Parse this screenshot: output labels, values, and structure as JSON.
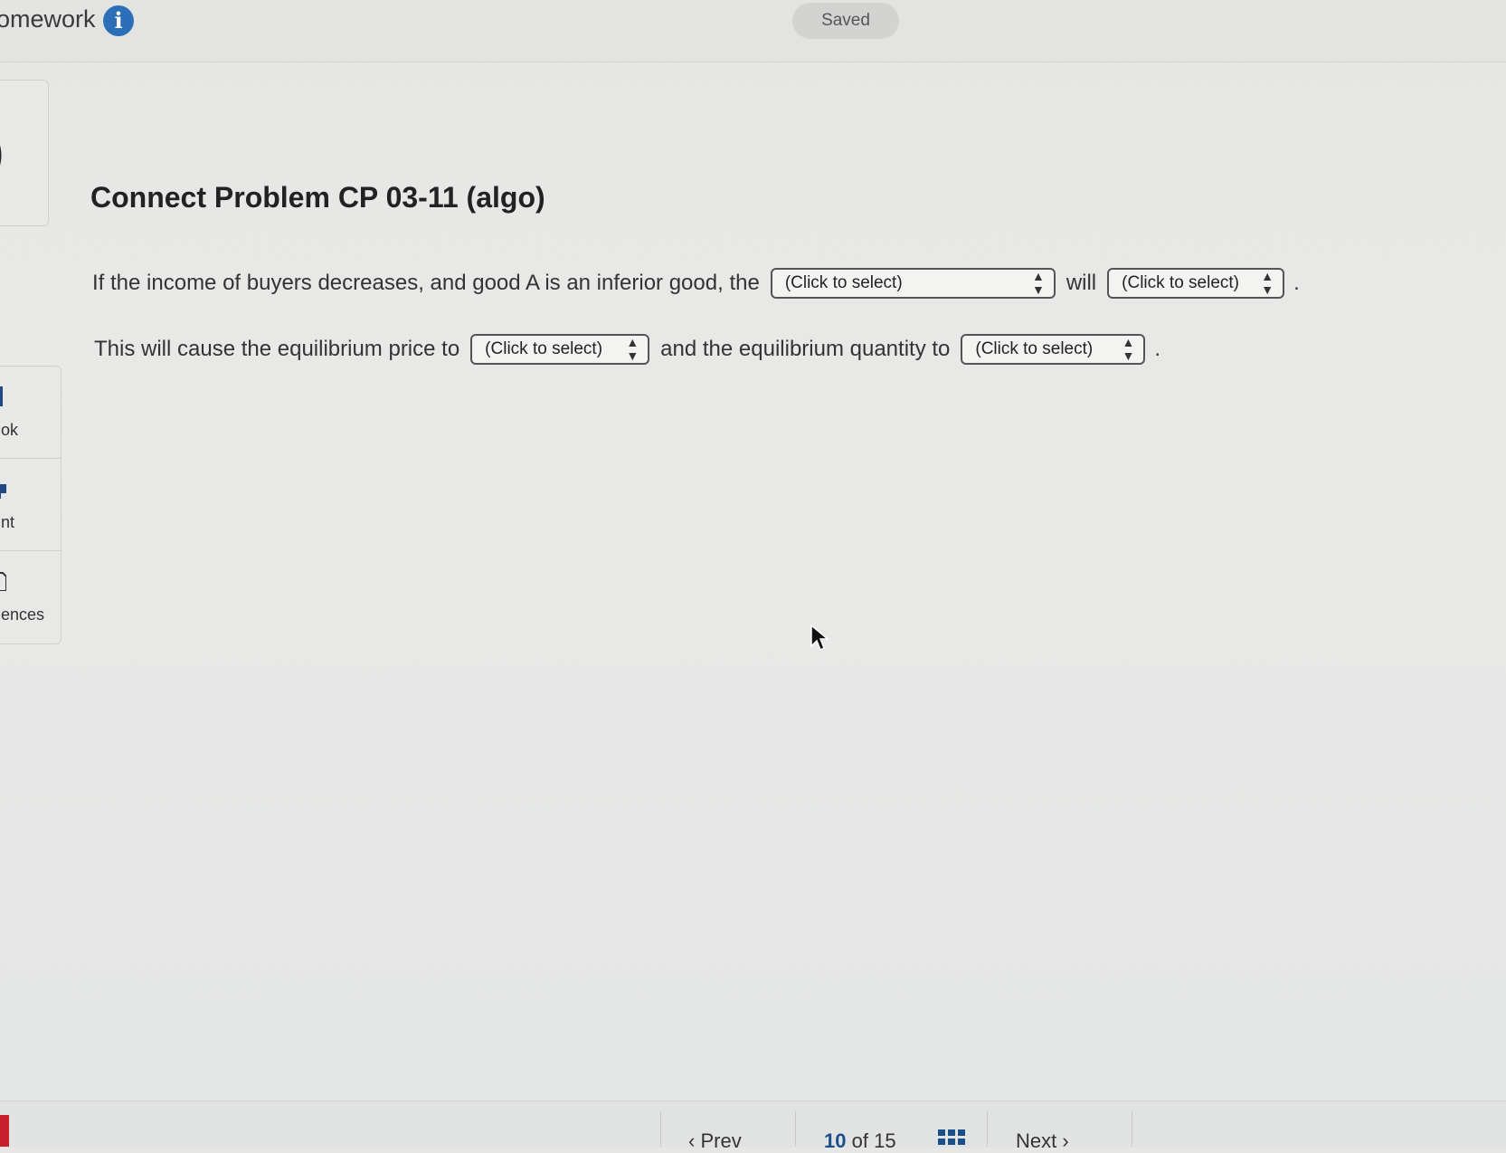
{
  "header": {
    "title": "omework",
    "info_icon": "i",
    "saved_label": "Saved"
  },
  "sidebar": {
    "items": [
      {
        "label": "ok",
        "icon": "book-icon"
      },
      {
        "label": "nt",
        "icon": "print-icon"
      },
      {
        "label": "ences",
        "icon": "references-icon"
      }
    ]
  },
  "problem": {
    "title": "Connect Problem CP 03-11 (algo)",
    "line1": {
      "text_before": "If the income of buyers decreases, and good A is an inferior good, the",
      "select1": "(Click to select)",
      "text_middle": "will",
      "select2": "(Click to select)",
      "text_end": "."
    },
    "line2": {
      "text_before": "This will cause the equilibrium price to",
      "select1": "(Click to select)",
      "text_middle": "and the equilibrium quantity to",
      "select2": "(Click to select)",
      "text_end": "."
    }
  },
  "footer": {
    "prev_label": "Prev",
    "current_page": "10",
    "of_label": "of",
    "total_pages": "15",
    "next_label": "Next"
  },
  "colors": {
    "info_blue": "#2a6fb8",
    "page_number_blue": "#1a4f8a",
    "red_tab": "#c8202a"
  }
}
